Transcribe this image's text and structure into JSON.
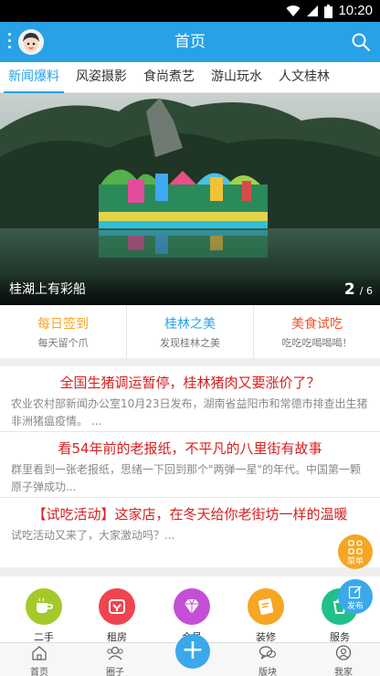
{
  "status_bar": {
    "time": "10:20"
  },
  "header": {
    "title": "首页"
  },
  "tabs": [
    "新闻爆料",
    "风姿摄影",
    "食尚煮艺",
    "游山玩水",
    "人文桂林"
  ],
  "banner": {
    "caption": "桂湖上有彩船",
    "page_current": "2",
    "page_total": "/ 6"
  },
  "shortcuts": [
    {
      "title": "每日签到",
      "subtitle": "每天留个爪",
      "color": "#f5a623"
    },
    {
      "title": "桂林之美",
      "subtitle": "发现桂林之美",
      "color": "#29a1e6"
    },
    {
      "title": "美食试吃",
      "subtitle": "吃吃吃喝喝喝！",
      "color": "#f0522f"
    }
  ],
  "news": [
    {
      "headline": "全国生猪调运暂停，桂林猪肉又要涨价了？",
      "summary": "农业农村部新闻办公室10月23日发布，湖南省益阳市和常德市排查出生猪非洲猪瘟疫情。 ..."
    },
    {
      "headline": "看54年前的老报纸，不平凡的八里街有故事",
      "summary": "群里看到一张老报纸，思绪一下回到那个\"两弹一星\"的年代。中国第一颗原子弹成功..."
    },
    {
      "headline": "【试吃活动】这家店，在冬天给你老街坊一样的温暖",
      "summary": "试吃活动又来了，大家激动吗？..."
    }
  ],
  "apps": [
    {
      "label": "二手",
      "color": "#a6c92a",
      "icon": "cup-icon"
    },
    {
      "label": "租房",
      "color": "#f0444f",
      "icon": "rent-icon"
    },
    {
      "label": "会员",
      "color": "#c44fd6",
      "icon": "diamond-icon"
    },
    {
      "label": "装修",
      "color": "#f5a623",
      "icon": "ticket-icon"
    },
    {
      "label": "服务",
      "color": "#20c08a",
      "icon": "service-icon"
    }
  ],
  "floating": {
    "menu_label": "菜单",
    "post_label": "发布"
  },
  "bottom_nav": [
    {
      "label": "首页",
      "icon": "home-icon"
    },
    {
      "label": "圈子",
      "icon": "group-icon"
    },
    {
      "label": "版块",
      "icon": "chat-icon"
    },
    {
      "label": "我家",
      "icon": "user-icon"
    }
  ],
  "colors": {
    "accent": "#29a1e6",
    "headline": "#d61f1f"
  }
}
